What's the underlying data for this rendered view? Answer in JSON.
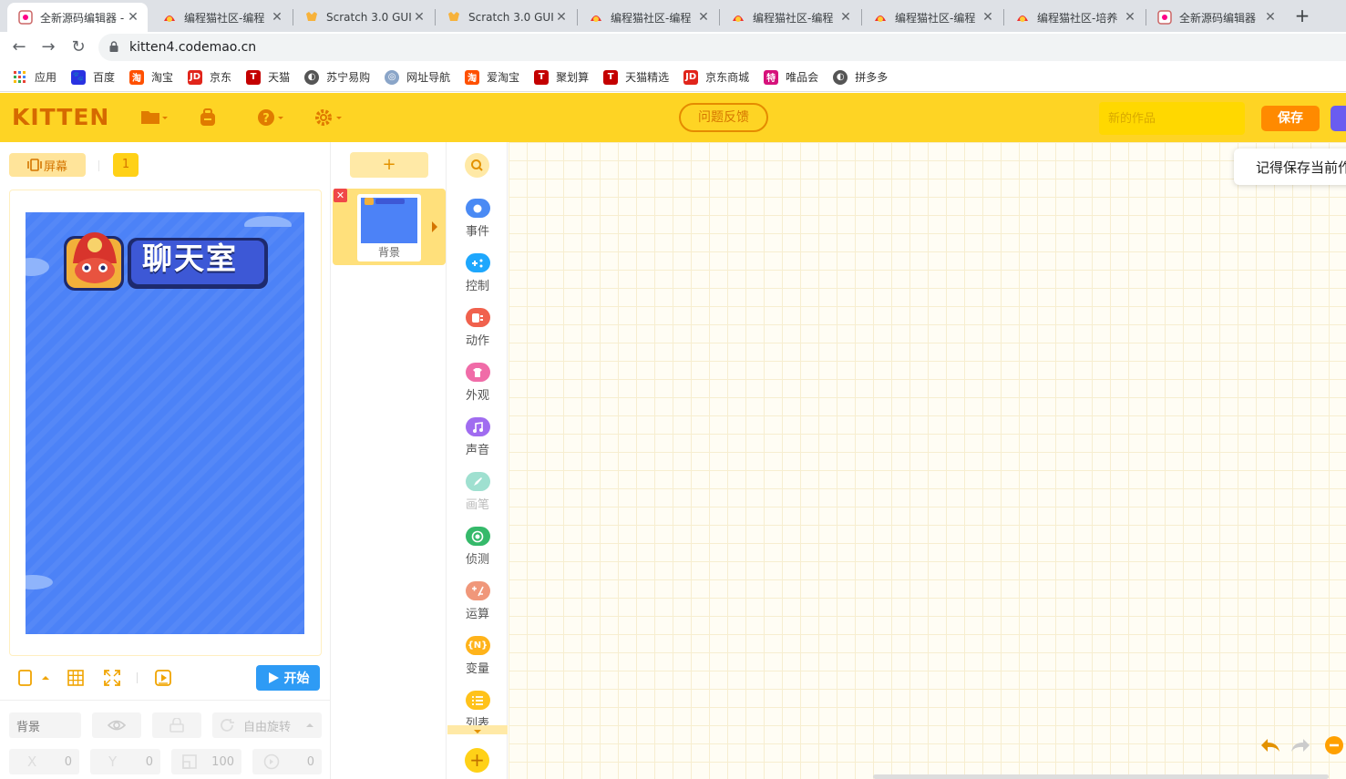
{
  "browser": {
    "tabs": [
      {
        "title": "全新源码编辑器 -",
        "icon": "kitten-favicon"
      },
      {
        "title": "编程猫社区-编程",
        "icon": "codemao-favicon"
      },
      {
        "title": "Scratch 3.0 GUI",
        "icon": "scratch-favicon"
      },
      {
        "title": "Scratch 3.0 GUI",
        "icon": "scratch-favicon"
      },
      {
        "title": "编程猫社区-编程",
        "icon": "codemao-favicon"
      },
      {
        "title": "编程猫社区-编程",
        "icon": "codemao-favicon"
      },
      {
        "title": "编程猫社区-编程",
        "icon": "codemao-favicon"
      },
      {
        "title": "编程猫社区-培养",
        "icon": "codemao-favicon"
      },
      {
        "title": "全新源码编辑器",
        "icon": "kitten-favicon"
      }
    ],
    "url": "kitten4.codemao.cn",
    "bookmarks": [
      {
        "label": "应用",
        "color": "#4285f4"
      },
      {
        "label": "百度",
        "color": "#2932e1"
      },
      {
        "label": "淘宝",
        "color": "#ff5000"
      },
      {
        "label": "京东",
        "color": "#e1251b"
      },
      {
        "label": "天猫",
        "color": "#c40000"
      },
      {
        "label": "苏宁易购",
        "color": "#555555"
      },
      {
        "label": "网址导航",
        "color": "#8aa5c8"
      },
      {
        "label": "爱淘宝",
        "color": "#ff5000"
      },
      {
        "label": "聚划算",
        "color": "#c40000"
      },
      {
        "label": "天猫精选",
        "color": "#c40000"
      },
      {
        "label": "京东商城",
        "color": "#e1251b"
      },
      {
        "label": "唯品会",
        "color": "#d6127b"
      },
      {
        "label": "拼多多",
        "color": "#555555"
      }
    ]
  },
  "header": {
    "logo": "KITTEN",
    "feedback_label": "问题反馈",
    "project_name_placeholder": "新的作品",
    "save_label": "保存",
    "accent": "#fed424"
  },
  "stage_panel": {
    "screen_label": "屏幕",
    "screen_number": "1",
    "stage_title": "聊天室",
    "start_label": "开始",
    "properties": {
      "name": "背景",
      "rotation_label": "自由旋转",
      "x_label": "X",
      "x_value": "0",
      "y_label": "Y",
      "y_value": "0",
      "size_value": "100",
      "direction_value": "0"
    }
  },
  "sprites": {
    "add_label": "+",
    "items": [
      {
        "name": "背景"
      }
    ]
  },
  "categories": [
    {
      "label": "事件",
      "color": "#4a8af4",
      "icon": "event-icon"
    },
    {
      "label": "控制",
      "color": "#1ea7fd",
      "icon": "control-icon"
    },
    {
      "label": "动作",
      "color": "#f0614d",
      "icon": "motion-icon"
    },
    {
      "label": "外观",
      "color": "#f06ca8",
      "icon": "looks-icon"
    },
    {
      "label": "声音",
      "color": "#a06cf0",
      "icon": "sound-icon"
    },
    {
      "label": "画笔",
      "color": "#9fe0d0",
      "icon": "pen-icon"
    },
    {
      "label": "侦测",
      "color": "#35b96a",
      "icon": "sensing-icon"
    },
    {
      "label": "运算",
      "color": "#f0977a",
      "icon": "operator-icon"
    },
    {
      "label": "变量",
      "color": "#ffb31a",
      "icon": "variable-icon"
    },
    {
      "label": "列表",
      "color": "#ffc21a",
      "icon": "list-icon"
    }
  ],
  "workspace": {
    "tooltip": "记得保存当前作"
  }
}
